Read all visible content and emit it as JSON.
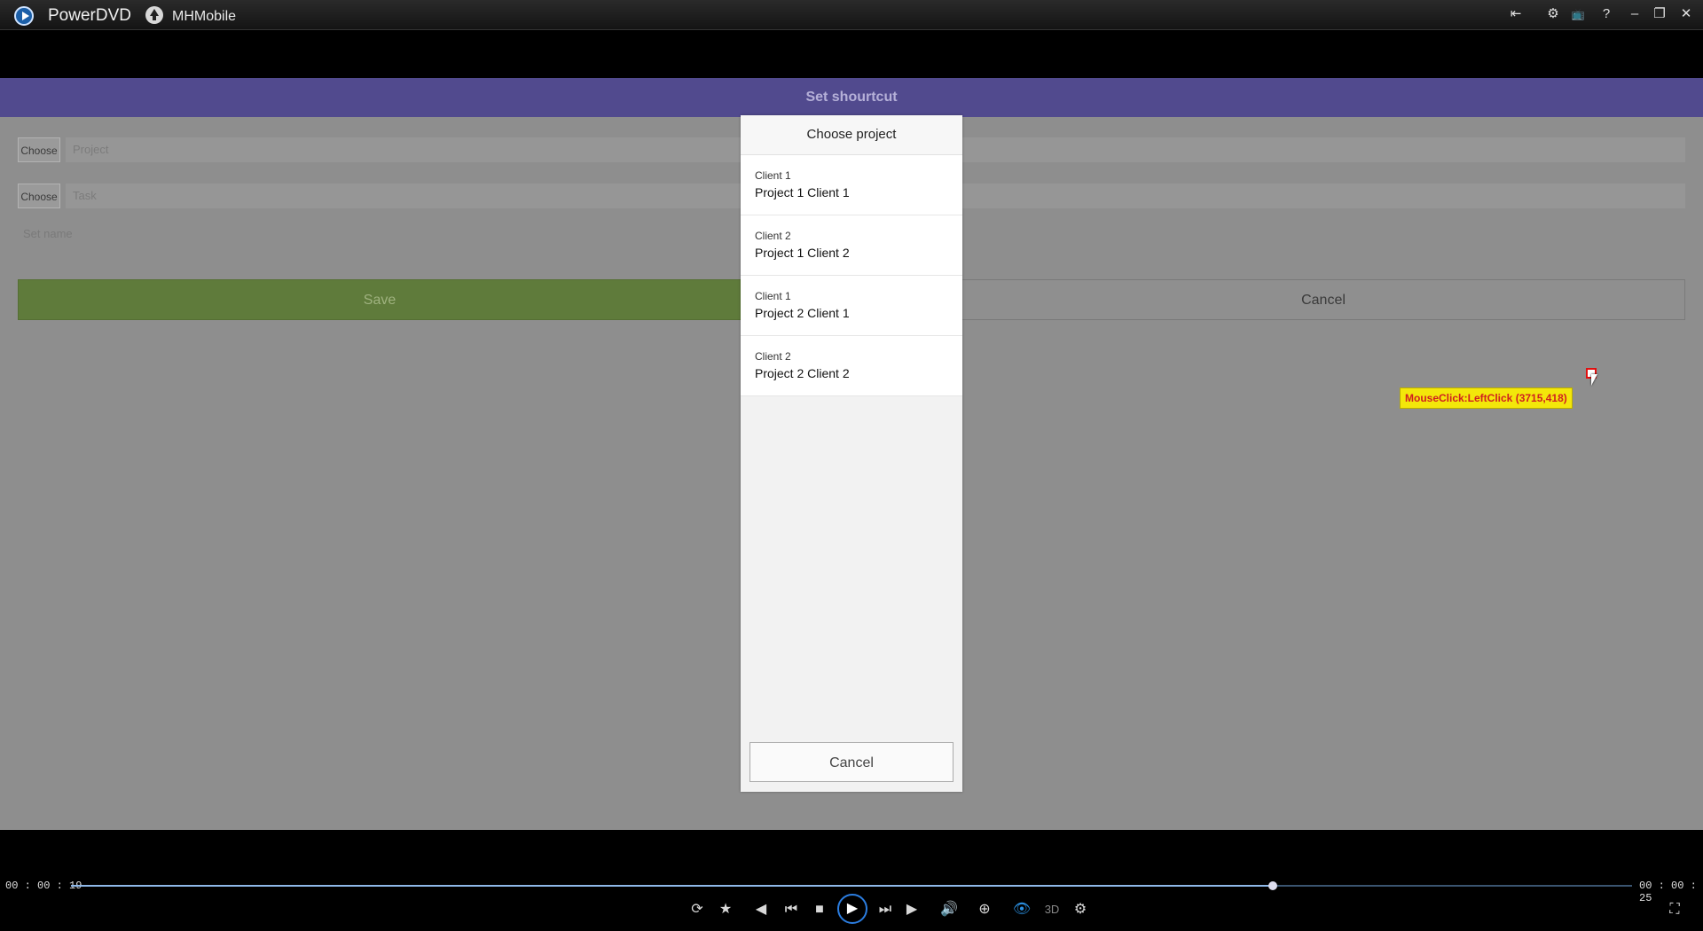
{
  "app": {
    "title": "PowerDVD",
    "media_title": "MHMobile"
  },
  "titlebar_icons": [
    "back-to-library-icon",
    "settings-icon",
    "tv-mode-icon",
    "help-icon",
    "minimize-icon",
    "restore-icon",
    "close-icon"
  ],
  "titlebar_glyphs": {
    "back": "⇤",
    "settings": "⚙",
    "tv": "📺",
    "help": "?",
    "minimize": "–",
    "restore": "❐",
    "close": "✕"
  },
  "page": {
    "banner_title": "Set shourtcut",
    "choose_label": "Choose",
    "project_placeholder": "Project",
    "task_placeholder": "Task",
    "set_name_placeholder": "Set name",
    "save_label": "Save",
    "cancel_label": "Cancel"
  },
  "dialog": {
    "title": "Choose project",
    "items": [
      {
        "client": "Client 1",
        "project": "Project 1 Client 1"
      },
      {
        "client": "Client 2",
        "project": "Project 1 Client 2"
      },
      {
        "client": "Client 1",
        "project": "Project 2 Client 1"
      },
      {
        "client": "Client 2",
        "project": "Project 2 Client 2"
      }
    ],
    "cancel_label": "Cancel"
  },
  "overlay": {
    "click_label": "MouseClick:LeftClick (3715,418)"
  },
  "player": {
    "time_elapsed": "00 : 00 : 19",
    "time_total": "00 : 00 : 25",
    "progress": 0.77,
    "colors": {
      "accent": "#2b7de0",
      "banner": "#514a8e",
      "save": "#5f7b3b"
    }
  }
}
